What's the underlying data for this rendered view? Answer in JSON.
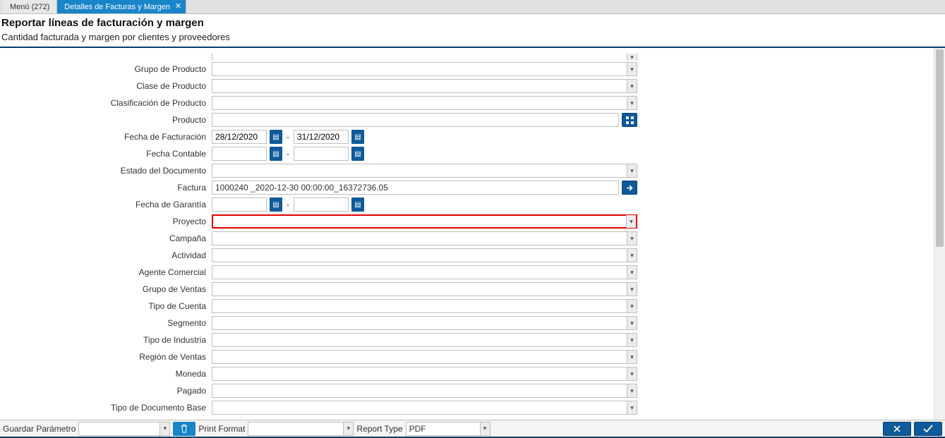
{
  "tabs": {
    "menu_label": "Menú (272)",
    "active_label": "Detalles de Facturas y Margen"
  },
  "header": {
    "title": "Reportar líneas de facturación y margen",
    "subtitle": "Cantidad facturada y margen por clientes y proveedores"
  },
  "labels": {
    "grupo_producto": "Grupo de Producto",
    "clase_producto": "Clase de Producto",
    "clasificacion_producto": "Clasificación de Producto",
    "producto": "Producto",
    "fecha_facturacion": "Fecha de Facturación",
    "fecha_contable": "Fecha Contable",
    "estado_documento": "Estado del Documento",
    "factura": "Factura",
    "fecha_garantia": "Fecha de Garantía",
    "proyecto": "Proyecto",
    "campana": "Campaña",
    "actividad": "Actividad",
    "agente_comercial": "Agente Comercial",
    "grupo_ventas": "Grupo de Ventas",
    "tipo_cuenta": "Tipo de Cuenta",
    "segmento": "Segmento",
    "tipo_industria": "Tipo de Industria",
    "region_ventas": "Región de Ventas",
    "moneda": "Moneda",
    "pagado": "Pagado",
    "tipo_documento_base": "Tipo de Documento Base"
  },
  "values": {
    "fecha_facturacion_from": "28/12/2020",
    "fecha_facturacion_to": "31/12/2020",
    "fecha_contable_from": "",
    "fecha_contable_to": "",
    "factura": "1000240 _2020-12-30 00:00:00_16372736.05",
    "fecha_garantia_from": "",
    "fecha_garantia_to": ""
  },
  "footer": {
    "guardar_parametro": "Guardar Parámetro",
    "print_format": "Print Format",
    "report_type": "Report Type",
    "report_type_value": "PDF"
  }
}
